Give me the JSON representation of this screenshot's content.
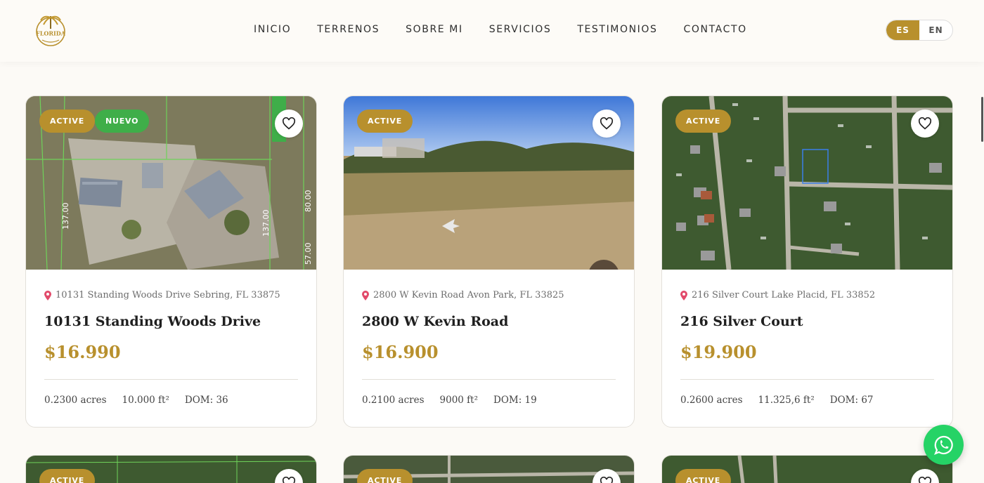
{
  "brand": {
    "logo_text": "FLORIDA"
  },
  "nav": {
    "items": [
      "INICIO",
      "TERRENOS",
      "SOBRE MI",
      "SERVICIOS",
      "TESTIMONIOS",
      "CONTACTO"
    ]
  },
  "lang": {
    "es": "ES",
    "en": "EN",
    "selected": "ES"
  },
  "colors": {
    "accent": "#b8902d",
    "new_badge": "#3fae49",
    "whatsapp": "#25d366"
  },
  "listings": [
    {
      "badges": [
        "ACTIVE",
        "NUEVO"
      ],
      "address": "10131 Standing Woods Drive Sebring, FL 33875",
      "title": "10131 Standing Woods Drive",
      "price": "$16.990",
      "acres": "0.2300 acres",
      "sqft": "10.000 ft²",
      "dom": "DOM: 36"
    },
    {
      "badges": [
        "ACTIVE"
      ],
      "address": "2800 W Kevin Road Avon Park, FL 33825",
      "title": "2800 W Kevin Road",
      "price": "$16.900",
      "acres": "0.2100 acres",
      "sqft": "9000 ft²",
      "dom": "DOM: 19"
    },
    {
      "badges": [
        "ACTIVE"
      ],
      "address": "216 Silver Court Lake Placid, FL 33852",
      "title": "216 Silver Court",
      "price": "$19.900",
      "acres": "0.2600 acres",
      "sqft": "11.325,6 ft²",
      "dom": "DOM: 67"
    }
  ],
  "partial_listings": [
    {
      "badge": "ACTIVE"
    },
    {
      "badge": "ACTIVE"
    },
    {
      "badge": "ACTIVE"
    }
  ],
  "icons": {
    "favorite": "heart-icon",
    "location": "map-pin-icon",
    "chat": "whatsapp-icon"
  }
}
